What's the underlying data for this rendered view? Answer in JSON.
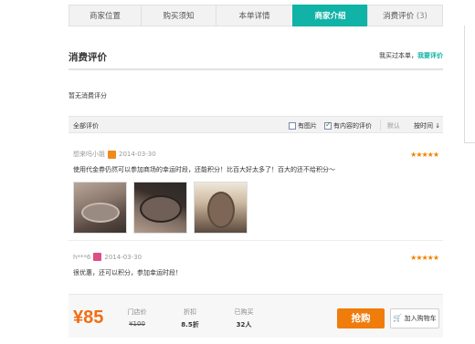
{
  "tabs": [
    {
      "label": "商家位置",
      "count": ""
    },
    {
      "label": "购买须知",
      "count": ""
    },
    {
      "label": "本单详情",
      "count": ""
    },
    {
      "label": "商家介绍",
      "count": "",
      "active": true
    },
    {
      "label": "消费评价",
      "count": "(3)"
    }
  ],
  "section": {
    "title": "消费评价",
    "bought_text": "我买过本单，",
    "write_link": "我要评价"
  },
  "no_reviews_text": "暂无消费评分",
  "filter": {
    "all_label": "全部评价",
    "has_image_label": "有图片",
    "has_image_checked": false,
    "has_content_label": "有内容的评价",
    "has_content_checked": true,
    "default_label": "默认",
    "sort_label": "按时间",
    "sort_arrow": "↓"
  },
  "reviews": [
    {
      "user": "想来吗小姐",
      "badge_color": "#f08a1c",
      "date": "2014-03-30",
      "stars": "★★★★★",
      "content": "使用代金券仍然可以参加商场的幸运时段，还能积分！比百大好太多了！百大的还不给积分～",
      "photos": [
        "shoe-photo-1",
        "shoe-photo-2",
        "shoe-photo-3"
      ]
    },
    {
      "user": "h***6",
      "badge_color": "#e04c87",
      "date": "2014-03-30",
      "stars": "★★★★★",
      "content": "很优惠，还可以积分，参加幸运时段！",
      "photos": []
    }
  ],
  "buybar": {
    "price": "¥85",
    "store_price_label": "门店价",
    "store_price_value": "¥100",
    "discount_label": "折扣",
    "discount_value": "8.5折",
    "sold_label": "已购买",
    "sold_value": "32人",
    "buy_button": "抢购",
    "cart_button": "加入购物车",
    "cart_icon": "cart-icon"
  },
  "colors": {
    "accent_teal": "#10b3a6",
    "accent_orange": "#f07c0c",
    "star": "#f08300"
  }
}
